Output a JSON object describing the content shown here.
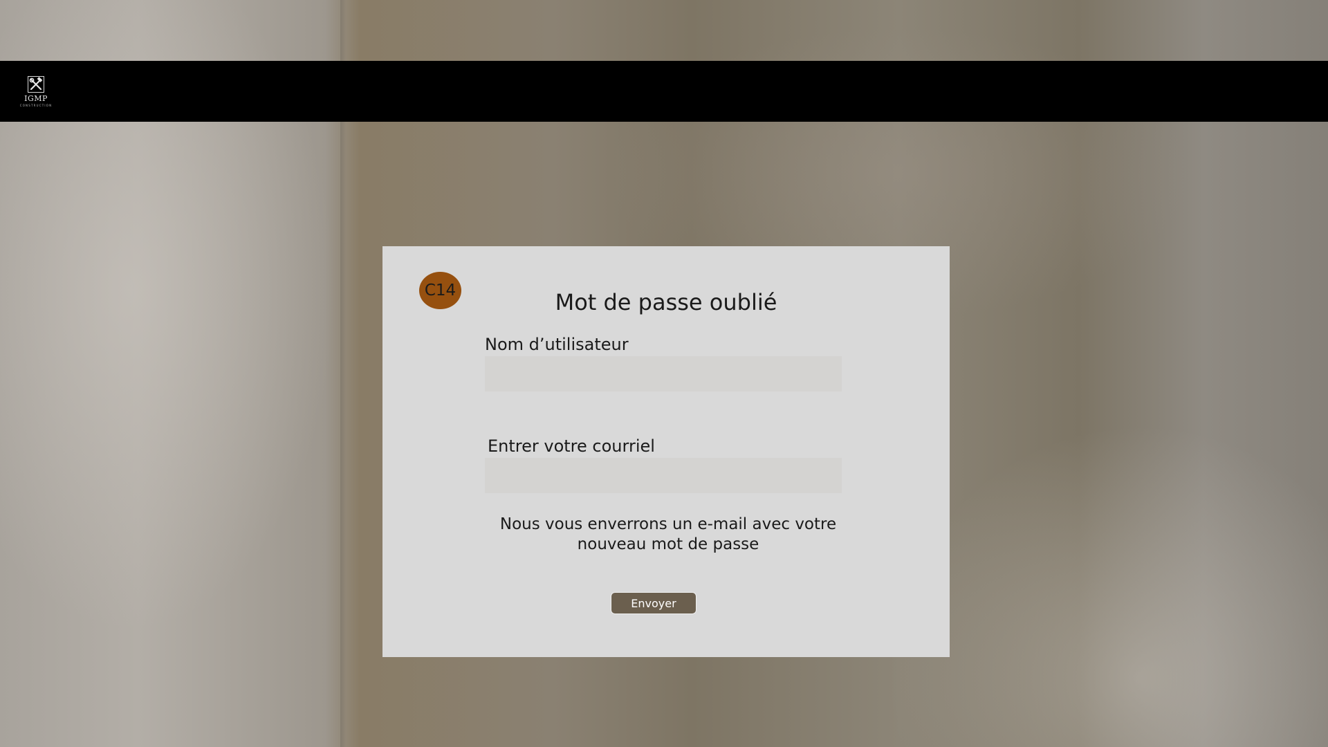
{
  "brand": {
    "name": "IGMP",
    "subtitle": "CONSTRUCTION",
    "icon": "hammer-wrench-icon"
  },
  "form": {
    "badge": "C14",
    "title": "Mot de passe oublié",
    "username_label": "Nom d’utilisateur",
    "username_value": "",
    "email_label": "Entrer votre courriel",
    "email_value": "",
    "info_line1": "Nous vous enverrons un e-mail avec votre",
    "info_line2": "nouveau mot de passe",
    "submit_label": "Envoyer"
  },
  "colors": {
    "header_bg": "#000000",
    "card_bg": "#d9d9d9",
    "input_bg": "#d4d3d1",
    "badge_bg": "#96500f",
    "button_bg": "#6b5f4e"
  }
}
